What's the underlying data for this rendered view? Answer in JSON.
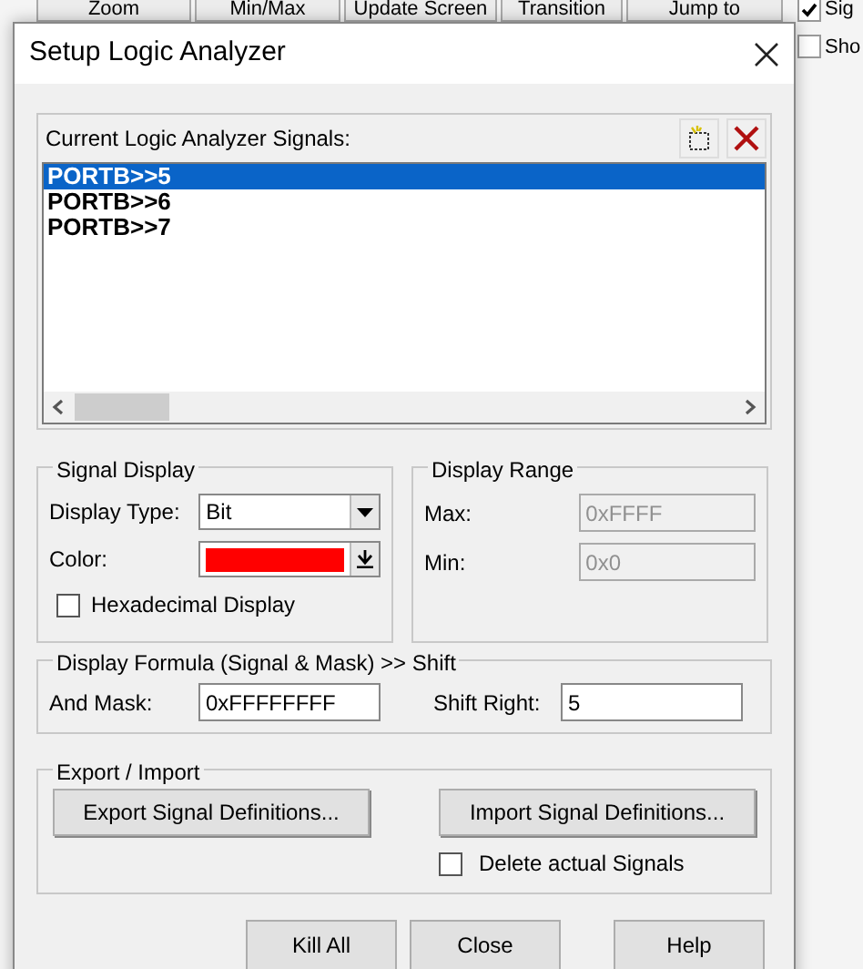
{
  "background_toolbar": {
    "buttons": [
      "Zoom",
      "Min/Max",
      "Update Screen",
      "Transition",
      "Jump to"
    ],
    "checkboxes": [
      {
        "label": "Sig",
        "checked": true
      },
      {
        "label": "Sho",
        "checked": false
      }
    ]
  },
  "dialog": {
    "title": "Setup Logic Analyzer",
    "signals": {
      "label": "Current Logic Analyzer Signals:",
      "items": [
        {
          "text": "PORTB>>5",
          "selected": true
        },
        {
          "text": "PORTB>>6",
          "selected": false
        },
        {
          "text": "PORTB>>7",
          "selected": false
        }
      ]
    },
    "signal_display": {
      "title": "Signal Display",
      "display_type": {
        "label": "Display Type:",
        "value": "Bit"
      },
      "color": {
        "label": "Color:",
        "color": "#ff0000"
      },
      "hexadecimal": {
        "label": "Hexadecimal Display",
        "checked": false
      }
    },
    "display_range": {
      "title": "Display Range",
      "max": {
        "label": "Max:",
        "value": "0xFFFF",
        "disabled": true
      },
      "min": {
        "label": "Min:",
        "value": "0x0",
        "disabled": true
      }
    },
    "formula": {
      "title": "Display Formula (Signal & Mask) >> Shift",
      "and_mask": {
        "label": "And Mask:",
        "value": "0xFFFFFFFF"
      },
      "shift_right": {
        "label": "Shift Right:",
        "value": "5"
      }
    },
    "export_import": {
      "title": "Export / Import",
      "buttons": [
        "Export Signal Definitions...",
        "Import Signal Definitions..."
      ],
      "delete_signals": {
        "label": "Delete actual Signals",
        "checked": false
      }
    },
    "buttons": [
      "Kill All",
      "Close",
      "Help"
    ]
  }
}
